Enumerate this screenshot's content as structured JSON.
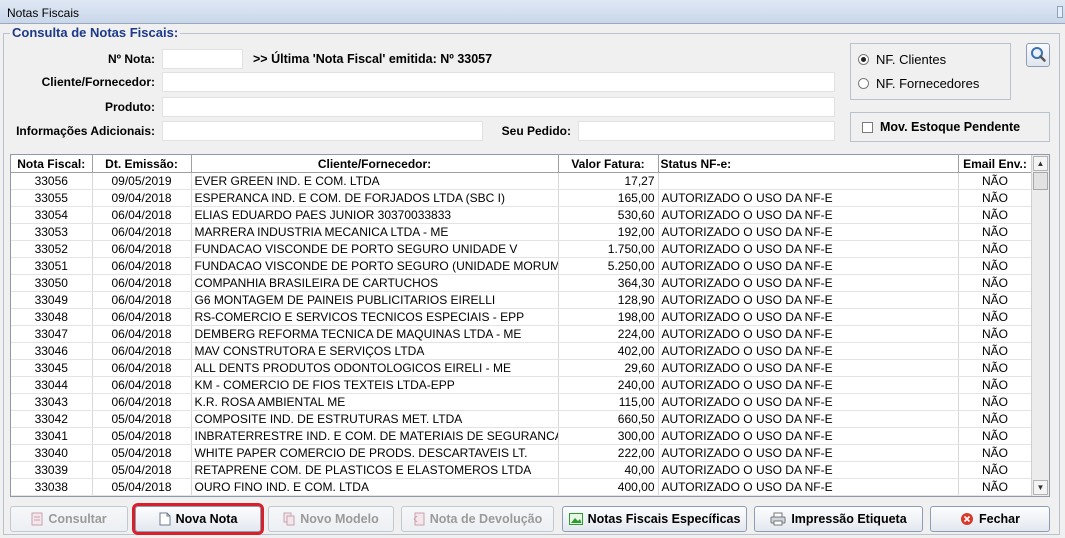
{
  "window": {
    "title": "Notas Fiscais"
  },
  "form": {
    "group_title": "Consulta de Notas Fiscais:",
    "nota_label": "Nº Nota:",
    "nota_value": "",
    "ultima_info": ">> Última 'Nota Fiscal' emitida: Nº 33057",
    "cliente_label": "Cliente/Fornecedor:",
    "cliente_value": "",
    "produto_label": "Produto:",
    "produto_value": "",
    "info_label": "Informações Adicionais:",
    "info_value": "",
    "pedido_label": "Seu Pedido:",
    "pedido_value": "",
    "radio_clientes": "NF. Clientes",
    "radio_fornecedores": "NF. Fornecedores",
    "selected_radio": "NF. Clientes",
    "check_label": "Mov. Estoque Pendente",
    "check_checked": false
  },
  "grid": {
    "columns": [
      "Nota Fiscal:",
      "Dt. Emissão:",
      "Cliente/Fornecedor:",
      "Valor Fatura:",
      "Status NF-e:",
      "Email Env.:"
    ],
    "rows": [
      [
        "33056",
        "09/05/2019",
        "EVER GREEN IND. E COM. LTDA",
        "17,27",
        "",
        "NÃO"
      ],
      [
        "33055",
        "09/04/2018",
        "ESPERANCA IND. E COM. DE FORJADOS LTDA (SBC I)",
        "165,00",
        "AUTORIZADO O USO DA NF-E",
        "NÃO"
      ],
      [
        "33054",
        "06/04/2018",
        "ELIAS EDUARDO PAES JUNIOR 30370033833",
        "530,60",
        "AUTORIZADO O USO DA NF-E",
        "NÃO"
      ],
      [
        "33053",
        "06/04/2018",
        "MARRERA INDUSTRIA MECANICA LTDA - ME",
        "192,00",
        "AUTORIZADO O USO DA NF-E",
        "NÃO"
      ],
      [
        "33052",
        "06/04/2018",
        "FUNDACAO VISCONDE DE PORTO SEGURO UNIDADE V",
        "1.750,00",
        "AUTORIZADO O USO DA NF-E",
        "NÃO"
      ],
      [
        "33051",
        "06/04/2018",
        "FUNDACAO VISCONDE DE PORTO SEGURO (UNIDADE MORUMBI)",
        "5.250,00",
        "AUTORIZADO O USO DA NF-E",
        "NÃO"
      ],
      [
        "33050",
        "06/04/2018",
        "COMPANHIA BRASILEIRA DE CARTUCHOS",
        "364,30",
        "AUTORIZADO O USO DA NF-E",
        "NÃO"
      ],
      [
        "33049",
        "06/04/2018",
        "G6 MONTAGEM DE PAINEIS PUBLICITARIOS EIRELLI",
        "128,90",
        "AUTORIZADO O USO DA NF-E",
        "NÃO"
      ],
      [
        "33048",
        "06/04/2018",
        "RS-COMERCIO E SERVICOS TECNICOS ESPECIAIS - EPP",
        "198,00",
        "AUTORIZADO O USO DA NF-E",
        "NÃO"
      ],
      [
        "33047",
        "06/04/2018",
        "DEMBERG REFORMA TECNICA DE MAQUINAS LTDA - ME",
        "224,00",
        "AUTORIZADO O USO DA NF-E",
        "NÃO"
      ],
      [
        "33046",
        "06/04/2018",
        "MAV CONSTRUTORA E SERVIÇOS LTDA",
        "402,00",
        "AUTORIZADO O USO DA NF-E",
        "NÃO"
      ],
      [
        "33045",
        "06/04/2018",
        "ALL DENTS PRODUTOS ODONTOLOGICOS EIRELI - ME",
        "29,60",
        "AUTORIZADO O USO DA NF-E",
        "NÃO"
      ],
      [
        "33044",
        "06/04/2018",
        "KM - COMERCIO DE FIOS TEXTEIS LTDA-EPP",
        "240,00",
        "AUTORIZADO O USO DA NF-E",
        "NÃO"
      ],
      [
        "33043",
        "06/04/2018",
        "K.R. ROSA AMBIENTAL ME",
        "115,00",
        "AUTORIZADO O USO DA NF-E",
        "NÃO"
      ],
      [
        "33042",
        "05/04/2018",
        "COMPOSITE IND. DE ESTRUTURAS MET. LTDA",
        "660,50",
        "AUTORIZADO O USO DA NF-E",
        "NÃO"
      ],
      [
        "33041",
        "05/04/2018",
        "INBRATERRESTRE IND. E COM. DE MATERIAIS DE SEGURANCA LT",
        "300,00",
        "AUTORIZADO O USO DA NF-E",
        "NÃO"
      ],
      [
        "33040",
        "05/04/2018",
        "WHITE PAPER COMERCIO DE PRODS. DESCARTAVEIS LT.",
        "222,00",
        "AUTORIZADO O USO DA NF-E",
        "NÃO"
      ],
      [
        "33039",
        "05/04/2018",
        "RETAPRENE COM. DE PLASTICOS E ELASTOMEROS LTDA",
        "40,00",
        "AUTORIZADO O USO DA NF-E",
        "NÃO"
      ],
      [
        "33038",
        "05/04/2018",
        "OURO FINO IND. E COM. LTDA",
        "400,00",
        "AUTORIZADO O USO DA NF-E",
        "NÃO"
      ]
    ]
  },
  "buttons": {
    "consultar": "Consultar",
    "nova_nota": "Nova Nota",
    "novo_modelo": "Novo Modelo",
    "nota_devolucao": "Nota de Devolução",
    "notas_especificas": "Notas Fiscais Específicas",
    "impressao_etiqueta": "Impressão Etiqueta",
    "fechar": "Fechar"
  },
  "colors": {
    "group_title": "#1d3a8a",
    "selected_outline": "#d9202a",
    "success_green": "#2e9b2e",
    "close_red": "#d83a2a"
  },
  "icons": {
    "consultar": "document-icon",
    "nova_nota": "new-document-icon",
    "novo_modelo": "copy-document-icon",
    "nota_devolucao": "return-document-icon",
    "notas_especificas": "image-icon",
    "impressao_etiqueta": "printer-icon",
    "fechar": "close-circle-icon",
    "search": "magnifier-icon"
  }
}
